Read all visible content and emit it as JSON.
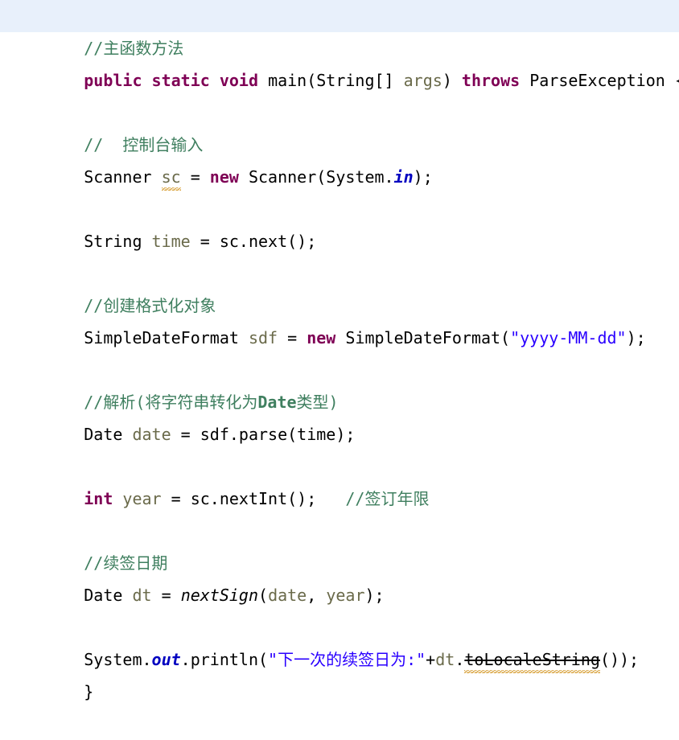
{
  "editor": {
    "language": "java",
    "background_color": "#ffffff",
    "current_line_highlight_color": "#e8f0fb",
    "colors": {
      "keyword": "#7f0055",
      "comment": "#3f7f5f",
      "string": "#2a00ff",
      "static_field": "#0000c0",
      "parameter": "#6a6a4a",
      "plain_text": "#000000",
      "warning_underline": "#d8a13a"
    }
  },
  "code": {
    "line1": {
      "comment": "//主函数方法"
    },
    "line2": {
      "kw_public": "public",
      "sp1": " ",
      "kw_static": "static",
      "sp2": " ",
      "kw_void": "void",
      "sp3": " ",
      "main_sig": "main(String[] ",
      "param_args": "args",
      "after_args": ") ",
      "kw_throws": "throws",
      "exception": " ParseException {"
    },
    "line4": {
      "comment": "//  控制台输入"
    },
    "line5": {
      "type": "Scanner ",
      "var": "sc",
      "eq": " = ",
      "kw_new": "new",
      "ctor": " Scanner(System.",
      "field_in": "in",
      "tail": ");"
    },
    "line7": {
      "type": "String ",
      "var": "time",
      "tail": " = sc.next();"
    },
    "line9": {
      "comment": "//创建格式化对象"
    },
    "line10": {
      "type": "SimpleDateFormat ",
      "var": "sdf",
      "eq": " = ",
      "kw_new": "new",
      "ctor": " SimpleDateFormat(",
      "string": "\"yyyy-MM-dd\"",
      "tail": ");"
    },
    "line12": {
      "comment_a": "//解析(将字符串转化为",
      "comment_b": "Date",
      "comment_c": "类型)"
    },
    "line13": {
      "type": "Date ",
      "var": "date",
      "tail": " = sdf.parse(time);"
    },
    "line15": {
      "kw_int": "int",
      "var": " year",
      "mid": " = sc.nextInt();",
      "gap": "   ",
      "comment": "//签订年限"
    },
    "line17": {
      "comment": "//续签日期"
    },
    "line18": {
      "type": "Date ",
      "var": "dt",
      "eq": " = ",
      "method": "nextSign",
      "open": "(",
      "arg1": "date",
      "comma": ", ",
      "arg2": "year",
      "tail": ");"
    },
    "line20": {
      "prefix": "System.",
      "field_out": "out",
      "mid": ".println(",
      "string": "\"下一次的续签日为:\"",
      "plus": "+",
      "var": "dt",
      "dot": ".",
      "deprecated_method": "toLocaleString",
      "tail": "());"
    },
    "line21": {
      "close_brace": "}"
    }
  }
}
